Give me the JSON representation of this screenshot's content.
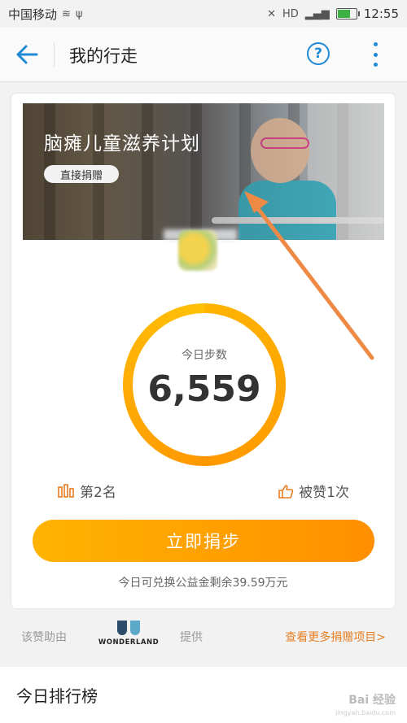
{
  "statusbar": {
    "carrier": "中国移动",
    "time": "12:55",
    "icons": [
      "wifi-icon",
      "usb-icon",
      "mute-icon",
      "hd-icon",
      "signal-icon",
      "battery-icon"
    ]
  },
  "appbar": {
    "title": "我的行走",
    "help_symbol": "?"
  },
  "banner": {
    "title": "脑瘫儿童滋养计划",
    "button_label": "直接捐赠"
  },
  "steps": {
    "label": "今日步数",
    "value": "6,559",
    "progress": 1.0
  },
  "stats": {
    "rank_text": "第2名",
    "likes_text": "被赞1次"
  },
  "donate": {
    "button_label": "立即捐步",
    "remain_text": "今日可兑换公益金剩余39.59万元"
  },
  "sponsor": {
    "prefix": "该赞助由",
    "brand": "WONDERLAND",
    "suffix": "提供",
    "more_link": "查看更多捐赠项目>"
  },
  "ranking": {
    "title": "今日排行榜"
  },
  "watermark": {
    "text": "Bai 经验",
    "subtext": "jingyan.baidu.com"
  },
  "colors": {
    "accent_blue": "#1e8ad6",
    "orange": "#ff9800",
    "link_orange": "#e67e22"
  }
}
